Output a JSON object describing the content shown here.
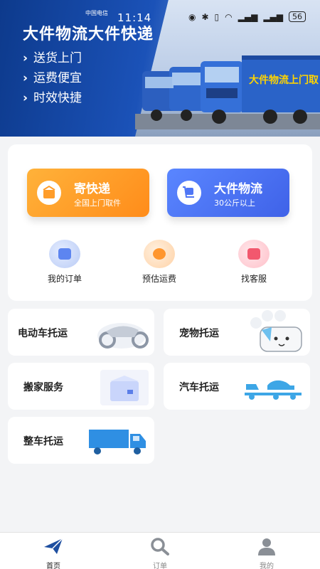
{
  "status_bar": {
    "carrier": "中国电信",
    "time": "11:14",
    "battery": "56"
  },
  "banner": {
    "title": "大件物流大件快递",
    "bullets": [
      "送货上门",
      "运费便宜",
      "时效快捷"
    ],
    "truck_text": "大件物流上门取件"
  },
  "actions": {
    "express": {
      "title": "寄快递",
      "subtitle": "全国上门取件"
    },
    "freight": {
      "title": "大件物流",
      "subtitle": "30公斤以上"
    }
  },
  "quick_links": [
    {
      "label": "我的订单",
      "icon": "order-icon"
    },
    {
      "label": "预估运费",
      "icon": "estimate-icon"
    },
    {
      "label": "找客服",
      "icon": "chat-icon"
    }
  ],
  "services": [
    {
      "label": "电动车托运",
      "icon": "motorcycle-icon"
    },
    {
      "label": "宠物托运",
      "icon": "pet-icon"
    },
    {
      "label": "搬家服务",
      "icon": "moving-box-icon"
    },
    {
      "label": "汽车托运",
      "icon": "car-carrier-icon"
    },
    {
      "label": "整车托运",
      "icon": "truck-icon"
    }
  ],
  "bottom_nav": [
    {
      "label": "首页",
      "icon": "paper-plane-icon",
      "active": true
    },
    {
      "label": "订单",
      "icon": "search-icon",
      "active": false
    },
    {
      "label": "我的",
      "icon": "person-icon",
      "active": false
    }
  ]
}
